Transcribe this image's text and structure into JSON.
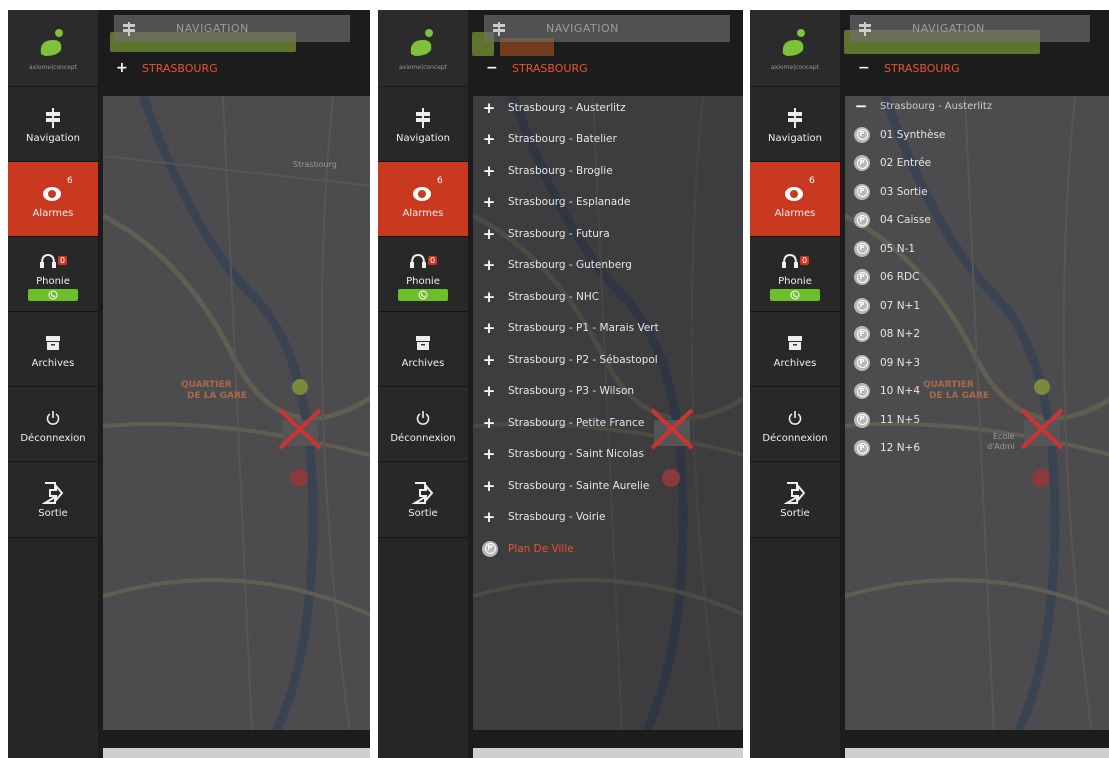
{
  "logo": {
    "text": "axiome|concept"
  },
  "sidebar": {
    "items": [
      {
        "label": "Navigation",
        "icon": "signpost-icon"
      },
      {
        "label": "Alarmes",
        "icon": "alarm-bell-icon",
        "count": "6"
      },
      {
        "label": "Phonie",
        "icon": "headset-icon",
        "count": "0"
      },
      {
        "label": "Archives",
        "icon": "archive-box-icon"
      },
      {
        "label": "Déconnexion",
        "icon": "power-icon"
      },
      {
        "label": "Sortie",
        "icon": "exit-icon"
      }
    ]
  },
  "navigation": {
    "title": "NAVIGATION"
  },
  "panel1": {
    "region": {
      "symbol": "+",
      "label": "STRASBOURG"
    }
  },
  "panel2": {
    "region": {
      "symbol": "−",
      "label": "STRASBOURG"
    },
    "items": [
      "Strasbourg - Austerlitz",
      "Strasbourg - Batelier",
      "Strasbourg - Broglie",
      "Strasbourg - Esplanade",
      "Strasbourg - Futura",
      "Strasbourg - Gutenberg",
      "Strasbourg - NHC",
      "Strasbourg - P1 - Marais Vert",
      "Strasbourg - P2 - Sébastopol",
      "Strasbourg - P3 - Wilson",
      "Strasbourg - Petite France",
      "Strasbourg - Saint Nicolas",
      "Strasbourg - Sainte Aurelie",
      "Strasbourg - Voirie"
    ],
    "plan": "Plan De Ville"
  },
  "panel3": {
    "region": {
      "symbol": "−",
      "label": "STRASBOURG"
    },
    "parking": {
      "symbol": "−",
      "label": "Strasbourg - Austerlitz"
    },
    "levels": [
      "01 Synthèse",
      "02 Entrée",
      "03 Sortie",
      "04 Caisse",
      "05 N-1",
      "06 RDC",
      "07 N+1",
      "08 N+2",
      "09 N+3",
      "10 N+4",
      "11 N+5",
      "12 N+6"
    ]
  },
  "map": {
    "labels": [
      "QUARTIER",
      "DE LA GARE",
      "Strasbourg",
      "Ecole",
      "d'Admi"
    ]
  },
  "colors": {
    "accent": "#c9391f",
    "region": "#e8542f",
    "phone_green": "#6bbf2a"
  }
}
